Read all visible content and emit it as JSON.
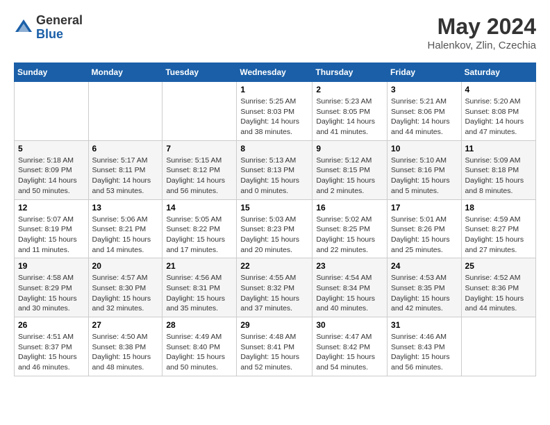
{
  "header": {
    "logo_general": "General",
    "logo_blue": "Blue",
    "title": "May 2024",
    "location": "Halenkov, Zlin, Czechia"
  },
  "days_of_week": [
    "Sunday",
    "Monday",
    "Tuesday",
    "Wednesday",
    "Thursday",
    "Friday",
    "Saturday"
  ],
  "weeks": [
    {
      "days": [
        {
          "num": "",
          "info": ""
        },
        {
          "num": "",
          "info": ""
        },
        {
          "num": "",
          "info": ""
        },
        {
          "num": "1",
          "info": "Sunrise: 5:25 AM\nSunset: 8:03 PM\nDaylight: 14 hours and 38 minutes."
        },
        {
          "num": "2",
          "info": "Sunrise: 5:23 AM\nSunset: 8:05 PM\nDaylight: 14 hours and 41 minutes."
        },
        {
          "num": "3",
          "info": "Sunrise: 5:21 AM\nSunset: 8:06 PM\nDaylight: 14 hours and 44 minutes."
        },
        {
          "num": "4",
          "info": "Sunrise: 5:20 AM\nSunset: 8:08 PM\nDaylight: 14 hours and 47 minutes."
        }
      ]
    },
    {
      "days": [
        {
          "num": "5",
          "info": "Sunrise: 5:18 AM\nSunset: 8:09 PM\nDaylight: 14 hours and 50 minutes."
        },
        {
          "num": "6",
          "info": "Sunrise: 5:17 AM\nSunset: 8:11 PM\nDaylight: 14 hours and 53 minutes."
        },
        {
          "num": "7",
          "info": "Sunrise: 5:15 AM\nSunset: 8:12 PM\nDaylight: 14 hours and 56 minutes."
        },
        {
          "num": "8",
          "info": "Sunrise: 5:13 AM\nSunset: 8:13 PM\nDaylight: 15 hours and 0 minutes."
        },
        {
          "num": "9",
          "info": "Sunrise: 5:12 AM\nSunset: 8:15 PM\nDaylight: 15 hours and 2 minutes."
        },
        {
          "num": "10",
          "info": "Sunrise: 5:10 AM\nSunset: 8:16 PM\nDaylight: 15 hours and 5 minutes."
        },
        {
          "num": "11",
          "info": "Sunrise: 5:09 AM\nSunset: 8:18 PM\nDaylight: 15 hours and 8 minutes."
        }
      ]
    },
    {
      "days": [
        {
          "num": "12",
          "info": "Sunrise: 5:07 AM\nSunset: 8:19 PM\nDaylight: 15 hours and 11 minutes."
        },
        {
          "num": "13",
          "info": "Sunrise: 5:06 AM\nSunset: 8:21 PM\nDaylight: 15 hours and 14 minutes."
        },
        {
          "num": "14",
          "info": "Sunrise: 5:05 AM\nSunset: 8:22 PM\nDaylight: 15 hours and 17 minutes."
        },
        {
          "num": "15",
          "info": "Sunrise: 5:03 AM\nSunset: 8:23 PM\nDaylight: 15 hours and 20 minutes."
        },
        {
          "num": "16",
          "info": "Sunrise: 5:02 AM\nSunset: 8:25 PM\nDaylight: 15 hours and 22 minutes."
        },
        {
          "num": "17",
          "info": "Sunrise: 5:01 AM\nSunset: 8:26 PM\nDaylight: 15 hours and 25 minutes."
        },
        {
          "num": "18",
          "info": "Sunrise: 4:59 AM\nSunset: 8:27 PM\nDaylight: 15 hours and 27 minutes."
        }
      ]
    },
    {
      "days": [
        {
          "num": "19",
          "info": "Sunrise: 4:58 AM\nSunset: 8:29 PM\nDaylight: 15 hours and 30 minutes."
        },
        {
          "num": "20",
          "info": "Sunrise: 4:57 AM\nSunset: 8:30 PM\nDaylight: 15 hours and 32 minutes."
        },
        {
          "num": "21",
          "info": "Sunrise: 4:56 AM\nSunset: 8:31 PM\nDaylight: 15 hours and 35 minutes."
        },
        {
          "num": "22",
          "info": "Sunrise: 4:55 AM\nSunset: 8:32 PM\nDaylight: 15 hours and 37 minutes."
        },
        {
          "num": "23",
          "info": "Sunrise: 4:54 AM\nSunset: 8:34 PM\nDaylight: 15 hours and 40 minutes."
        },
        {
          "num": "24",
          "info": "Sunrise: 4:53 AM\nSunset: 8:35 PM\nDaylight: 15 hours and 42 minutes."
        },
        {
          "num": "25",
          "info": "Sunrise: 4:52 AM\nSunset: 8:36 PM\nDaylight: 15 hours and 44 minutes."
        }
      ]
    },
    {
      "days": [
        {
          "num": "26",
          "info": "Sunrise: 4:51 AM\nSunset: 8:37 PM\nDaylight: 15 hours and 46 minutes."
        },
        {
          "num": "27",
          "info": "Sunrise: 4:50 AM\nSunset: 8:38 PM\nDaylight: 15 hours and 48 minutes."
        },
        {
          "num": "28",
          "info": "Sunrise: 4:49 AM\nSunset: 8:40 PM\nDaylight: 15 hours and 50 minutes."
        },
        {
          "num": "29",
          "info": "Sunrise: 4:48 AM\nSunset: 8:41 PM\nDaylight: 15 hours and 52 minutes."
        },
        {
          "num": "30",
          "info": "Sunrise: 4:47 AM\nSunset: 8:42 PM\nDaylight: 15 hours and 54 minutes."
        },
        {
          "num": "31",
          "info": "Sunrise: 4:46 AM\nSunset: 8:43 PM\nDaylight: 15 hours and 56 minutes."
        },
        {
          "num": "",
          "info": ""
        }
      ]
    }
  ]
}
